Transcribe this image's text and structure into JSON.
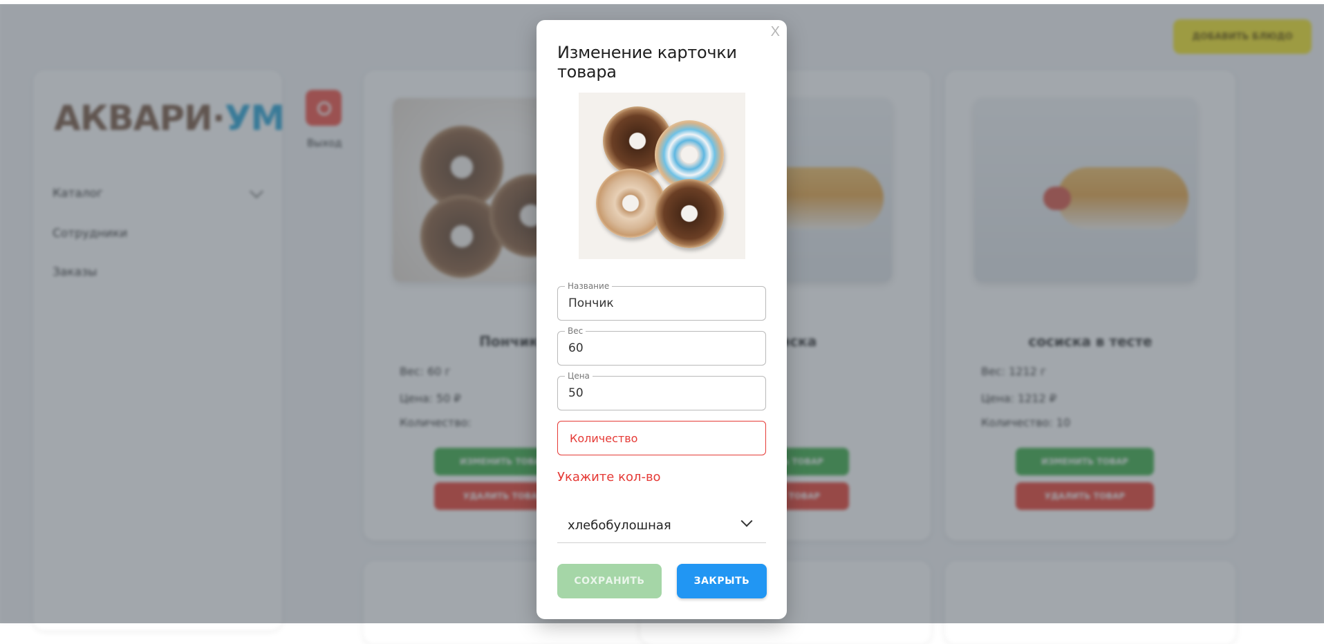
{
  "background_app": {
    "logo": {
      "part1": "АКВАРИ·",
      "part2": "УМ"
    },
    "sidebar_items": [
      {
        "label": "Каталог"
      },
      {
        "label": "Сотрудники"
      },
      {
        "label": "Заказы"
      }
    ],
    "exit_label": "Выход",
    "add_dish_label": "добавить блюдо",
    "cards": [
      {
        "title": "Пончик",
        "lines": [
          "Вес: 60 г",
          "Цена: 50 ₽",
          "Количество:"
        ],
        "edit_label": "изменить товар",
        "delete_label": "удалить товар"
      },
      {
        "title": "сосиска",
        "lines": [
          "",
          "",
          ""
        ],
        "edit_label": "изменить товар",
        "delete_label": "удалить товар"
      },
      {
        "title": "сосиска в тесте",
        "lines": [
          "Вес: 1212 г",
          "Цена: 1212 ₽",
          "Количество: 10"
        ],
        "edit_label": "изменить товар",
        "delete_label": "удалить товар"
      }
    ]
  },
  "modal": {
    "close_label": "X",
    "title": "Изменение карточки товара",
    "fields": {
      "name": {
        "label": "Название",
        "value": "Пончик"
      },
      "weight": {
        "label": "Вес",
        "value": "60"
      },
      "price": {
        "label": "Цена",
        "value": "50"
      },
      "quantity": {
        "placeholder": "Количество"
      }
    },
    "quantity_error": "Укажите кол-во",
    "category_select": {
      "value": "хлебобулошная"
    },
    "buttons": {
      "save": "СОХРАНИТЬ",
      "close": "ЗАКРЫТЬ"
    },
    "colors": {
      "error": "#e53935",
      "primary": "#2196f3",
      "save_disabled": "#a5d6a7"
    }
  }
}
